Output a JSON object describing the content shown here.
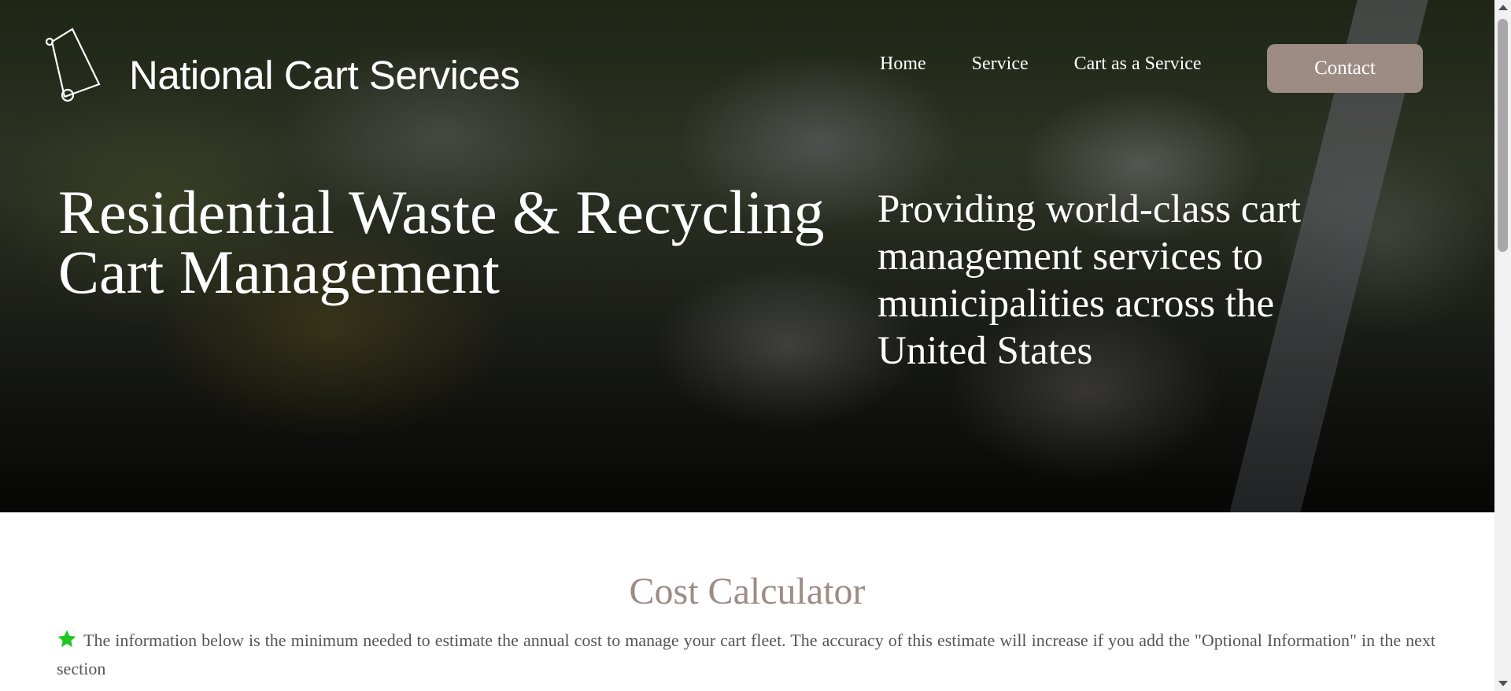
{
  "brand": {
    "name": "National Cart Services",
    "logo_icon": "cart-icon"
  },
  "nav": {
    "items": [
      {
        "label": "Home"
      },
      {
        "label": "Service"
      },
      {
        "label": "Cart as a Service"
      }
    ],
    "contact_label": "Contact"
  },
  "hero": {
    "title": "Residential Waste & Recycling Cart Management",
    "subtitle": "Providing world-class cart management services to municipalities across the United States"
  },
  "calculator": {
    "title": "Cost Calculator",
    "note_icon": "star-icon",
    "note": "The information below is the minimum needed to estimate the annual cost to manage your cart fleet. The accuracy of this estimate will increase if you add the \"Optional Information\" in the next section"
  },
  "colors": {
    "accent": "#9d8c84",
    "star": "#22c522",
    "body_text": "#555555"
  }
}
